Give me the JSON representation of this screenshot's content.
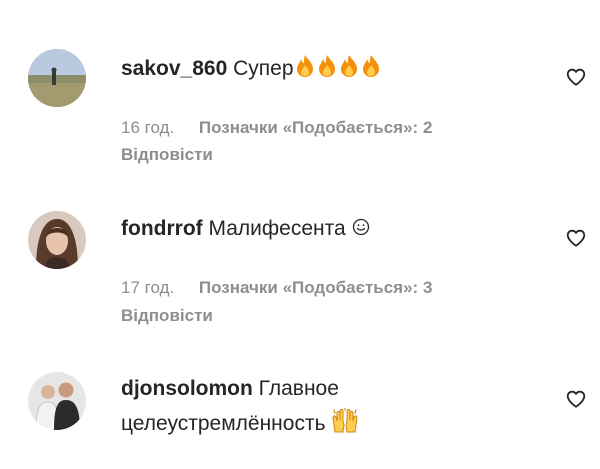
{
  "comments": [
    {
      "username": "sakov_860",
      "text": "Супер",
      "emoji": "fire-icon ×4",
      "time": "16 год.",
      "likes_label": "Позначки «Подобається»: 2",
      "reply_label": "Відповісти"
    },
    {
      "username": "fondrrof",
      "text": "Малифесента",
      "emoji": "slightly-smiling-face-icon",
      "time": "17 год.",
      "likes_label": "Позначки «Подобається»: 3",
      "reply_label": "Відповісти"
    },
    {
      "username": "djonsolomon",
      "text_line1": "Главное",
      "text_line2": "целеустремлённость",
      "emoji": "raising-hands-icon"
    }
  ],
  "colors": {
    "primary_text": "#262626",
    "secondary_text": "#8e8e8e",
    "fire": "#f4900c",
    "fire_inner": "#ffcc4d"
  }
}
